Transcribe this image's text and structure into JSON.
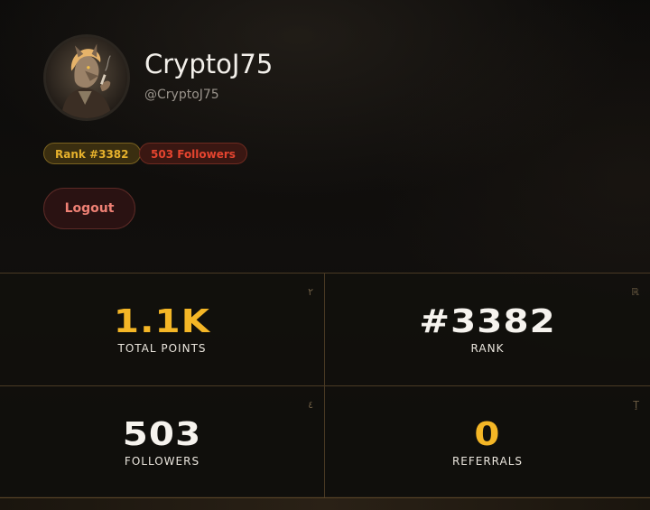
{
  "profile": {
    "username": "CryptoJ75",
    "handle": "@CryptoJ75",
    "avatar_icon": "wolf-portrait-avatar"
  },
  "badges": {
    "rank": "Rank #3382",
    "followers": "503 Followers"
  },
  "actions": {
    "logout_label": "Logout"
  },
  "stats": [
    {
      "value": "1.1K",
      "label": "TOTAL POINTS",
      "glyph": "٢",
      "color": "#f4b626"
    },
    {
      "value": "#3382",
      "label": "RANK",
      "glyph": "ℝ",
      "color": "#f6f3ee"
    },
    {
      "value": "503",
      "label": "FOLLOWERS",
      "glyph": "٤",
      "color": "#f6f3ee"
    },
    {
      "value": "0",
      "label": "REFERRALS",
      "glyph": "Ţ",
      "color": "#f4b626"
    }
  ],
  "colors": {
    "accent_gold": "#f4b626",
    "badge_red": "#e4442f",
    "logout_text": "#ee8074"
  }
}
